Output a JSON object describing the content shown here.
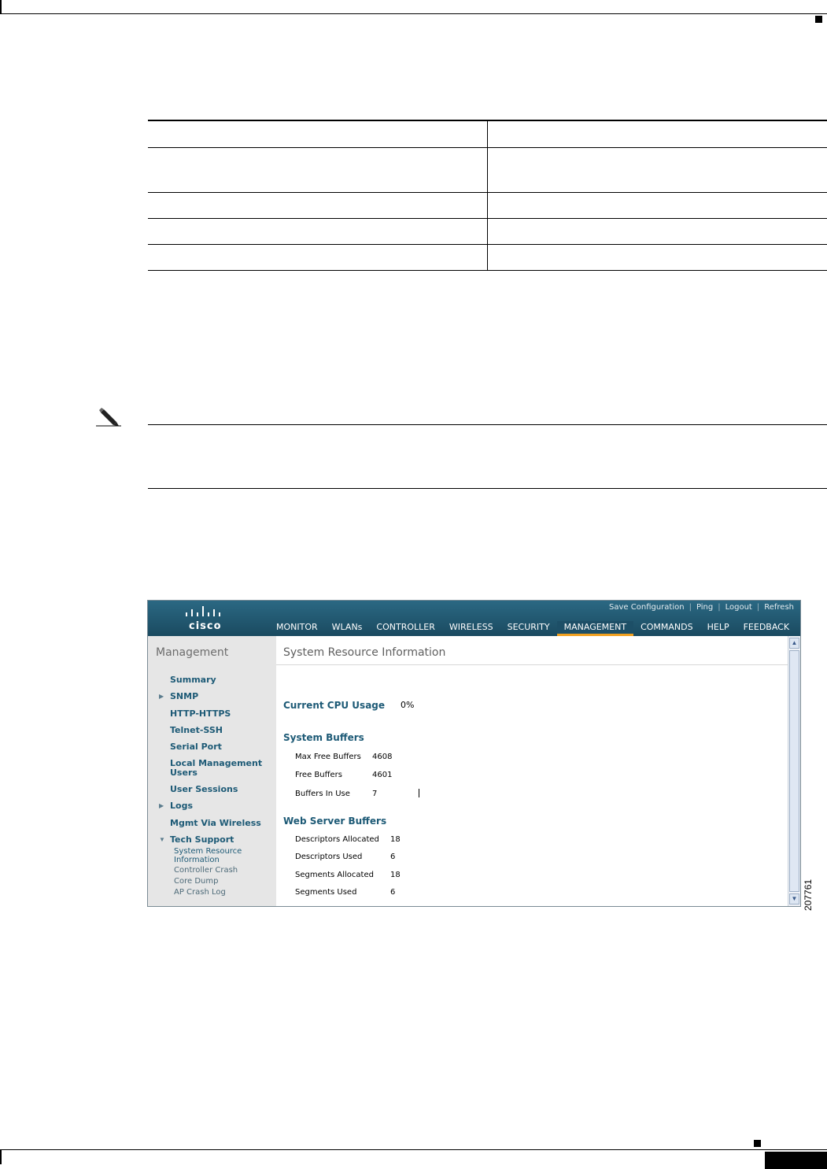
{
  "document": {
    "figure_number": "207761"
  },
  "ui": {
    "brand": "cisco",
    "top_links": [
      "Save Configuration",
      "Ping",
      "Logout",
      "Refresh"
    ],
    "nav": [
      "MONITOR",
      "WLANs",
      "CONTROLLER",
      "WIRELESS",
      "SECURITY",
      "MANAGEMENT",
      "COMMANDS",
      "HELP",
      "FEEDBACK"
    ],
    "active_nav": "MANAGEMENT",
    "sidebar": {
      "title": "Management",
      "items": [
        {
          "label": "Summary",
          "arrow": ""
        },
        {
          "label": "SNMP",
          "arrow": "right"
        },
        {
          "label": "HTTP-HTTPS",
          "arrow": ""
        },
        {
          "label": "Telnet-SSH",
          "arrow": ""
        },
        {
          "label": "Serial Port",
          "arrow": ""
        },
        {
          "label": "Local Management Users",
          "arrow": ""
        },
        {
          "label": "User Sessions",
          "arrow": ""
        },
        {
          "label": "Logs",
          "arrow": "right"
        },
        {
          "label": "Mgmt Via Wireless",
          "arrow": ""
        },
        {
          "label": "Tech Support",
          "arrow": "down"
        }
      ],
      "subitems": [
        "System Resource Information",
        "Controller Crash",
        "Core Dump",
        "AP Crash Log"
      ]
    },
    "main": {
      "title": "System Resource Information",
      "cpu": {
        "label": "Current CPU Usage",
        "value": "0%"
      },
      "system_buffers": {
        "heading": "System Buffers",
        "rows": [
          {
            "label": "Max Free Buffers",
            "value": "4608"
          },
          {
            "label": "Free Buffers",
            "value": "4601"
          },
          {
            "label": "Buffers In Use",
            "value": "7"
          }
        ]
      },
      "web_server_buffers": {
        "heading": "Web Server Buffers",
        "rows": [
          {
            "label": "Descriptors Allocated",
            "value": "18"
          },
          {
            "label": "Descriptors Used",
            "value": "6"
          },
          {
            "label": "Segments Allocated",
            "value": "18"
          },
          {
            "label": "Segments Used",
            "value": "6"
          }
        ]
      }
    }
  }
}
